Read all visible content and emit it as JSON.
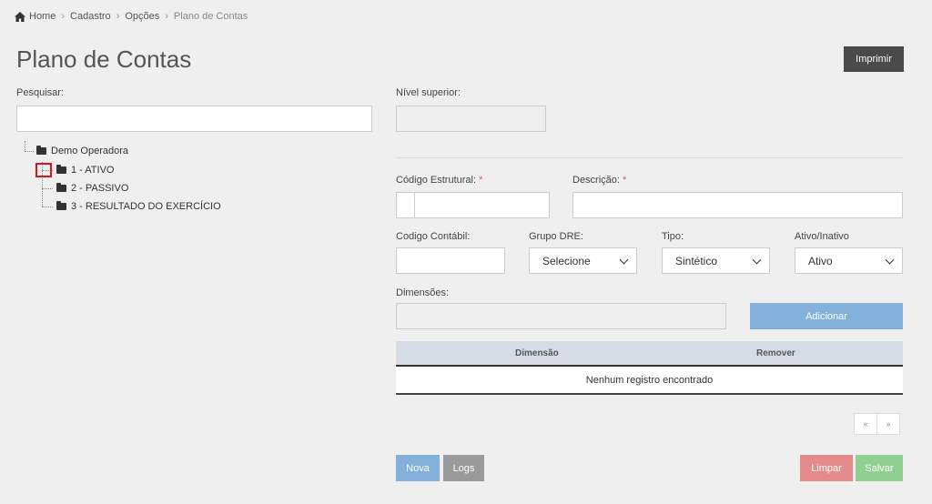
{
  "breadcrumb": {
    "home": "Home",
    "items": [
      "Cadastro",
      "Opções"
    ],
    "current": "Plano de Contas"
  },
  "page_title": "Plano de Contas",
  "print_button": "Imprimir",
  "search": {
    "label": "Pesquisar:",
    "value": ""
  },
  "tree": {
    "root": "Demo Operadora",
    "children": [
      "1 - ATIVO",
      "2 - PASSIVO",
      "3 - RESULTADO DO EXERCÍCIO"
    ]
  },
  "form": {
    "nivel_superior": {
      "label": "Nível superior:",
      "value": ""
    },
    "codigo_estrutural": {
      "label": "Código Estrutural:",
      "required_mark": "*",
      "value": ""
    },
    "descricao": {
      "label": "Descrição:",
      "required_mark": "*",
      "value": ""
    },
    "codigo_contabil": {
      "label": "Codigo Contábil:",
      "value": ""
    },
    "grupo_dre": {
      "label": "Grupo DRE:",
      "selected": "Selecione"
    },
    "tipo": {
      "label": "Tipo:",
      "selected": "Sintético"
    },
    "ativo_inativo": {
      "label": "Ativo/Inativo",
      "selected": "Ativo"
    },
    "dimensoes": {
      "label": "Dimensões:",
      "value": ""
    },
    "add_button": "Adicionar"
  },
  "table": {
    "headers": [
      "Dimensão",
      "Remover"
    ],
    "empty_message": "Nenhum registro encontrado"
  },
  "pagination": {
    "prev": "«",
    "next": "»"
  },
  "actions": {
    "nova": "Nova",
    "logs": "Logs",
    "limpar": "Limpar",
    "salvar": "Salvar"
  },
  "colors": {
    "primary": "#83b1dc",
    "danger": "#e58a8a",
    "success": "#8fcf8f",
    "dark": "#4a4a4a",
    "gray": "#9a9a9a",
    "highlight": "#e0141e"
  }
}
